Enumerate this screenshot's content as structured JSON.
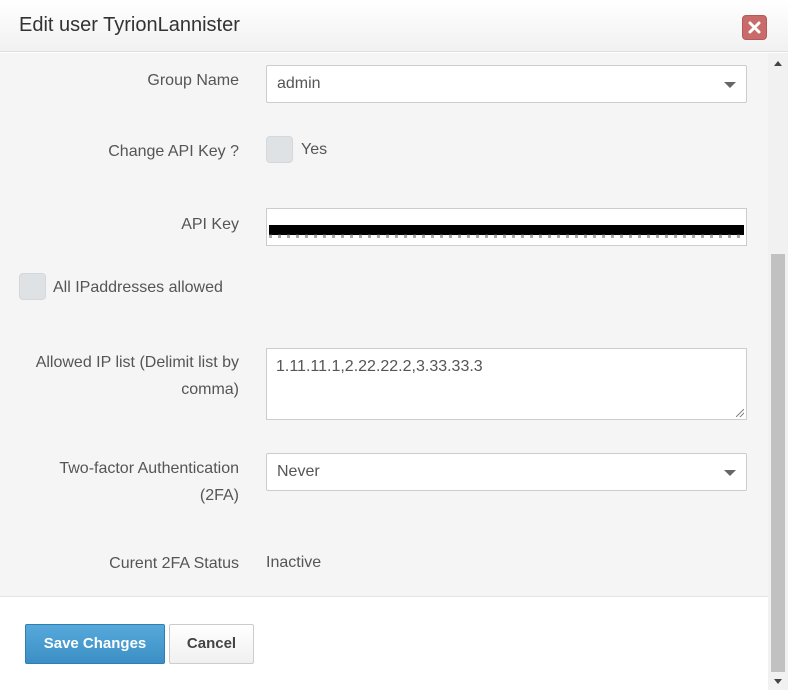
{
  "dialog": {
    "title": "Edit user TyrionLannister",
    "close_icon": "close-icon"
  },
  "form": {
    "group_name": {
      "label": "Group Name",
      "value": "admin"
    },
    "change_api_key": {
      "label": "Change API Key ?",
      "checkbox_label": "Yes",
      "checked": false
    },
    "api_key": {
      "label": "API Key",
      "value_redacted": true
    },
    "all_ip_allowed": {
      "checkbox_label": "All IPaddresses allowed",
      "checked": false
    },
    "allowed_ip_list": {
      "label_line1": "Allowed IP list (Delimit list by",
      "label_line2": "comma)",
      "value": "1.11.11.1,2.22.22.2,3.33.33.3"
    },
    "two_factor": {
      "label_line1": "Two-factor Authentication",
      "label_line2": "(2FA)",
      "value": "Never"
    },
    "current_2fa": {
      "label": "Curent 2FA Status",
      "value": "Inactive"
    }
  },
  "footer": {
    "save_label": "Save Changes",
    "cancel_label": "Cancel"
  },
  "colors": {
    "primary_button": "#3b8fc4",
    "close_button": "#c96b6b",
    "checkbox": "#dfe2e5"
  }
}
